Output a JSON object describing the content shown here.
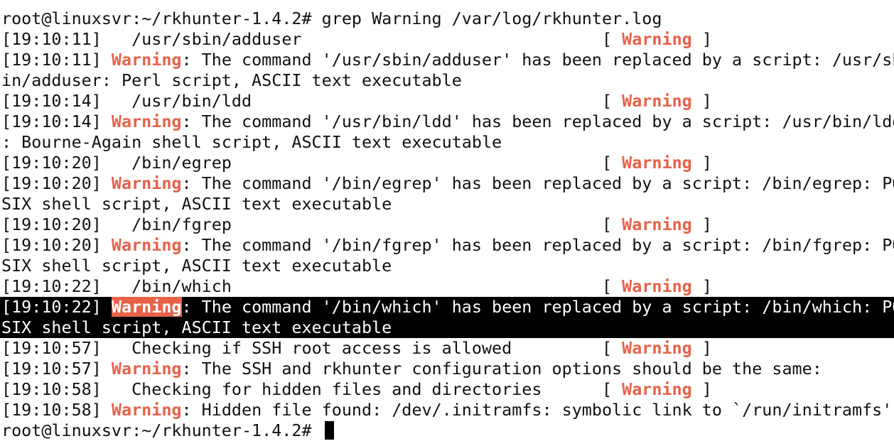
{
  "terminal": {
    "command_line": {
      "prompt": "root@linuxsvr:~/rkhunter-1.4.2#",
      "command": "grep Warning /var/log/rkhunter.log"
    },
    "warning_word": "Warning",
    "status_open": "[ ",
    "status_close": " ]",
    "lines": [
      {
        "kind": "status",
        "time": "[19:10:11]",
        "text": "  /usr/sbin/adduser"
      },
      {
        "kind": "message",
        "time": "[19:10:11]",
        "text": ": The command '/usr/sbin/adduser' has been replaced by a script: /usr/sb"
      },
      {
        "kind": "cont",
        "text": "in/adduser: Perl script, ASCII text executable"
      },
      {
        "kind": "status",
        "time": "[19:10:14]",
        "text": "  /usr/bin/ldd"
      },
      {
        "kind": "message",
        "time": "[19:10:14]",
        "text": ": The command '/usr/bin/ldd' has been replaced by a script: /usr/bin/ldd"
      },
      {
        "kind": "cont",
        "text": ": Bourne-Again shell script, ASCII text executable"
      },
      {
        "kind": "status",
        "time": "[19:10:20]",
        "text": "  /bin/egrep"
      },
      {
        "kind": "message",
        "time": "[19:10:20]",
        "text": ": The command '/bin/egrep' has been replaced by a script: /bin/egrep: PO"
      },
      {
        "kind": "cont",
        "text": "SIX shell script, ASCII text executable"
      },
      {
        "kind": "status",
        "time": "[19:10:20]",
        "text": "  /bin/fgrep"
      },
      {
        "kind": "message",
        "time": "[19:10:20]",
        "text": ": The command '/bin/fgrep' has been replaced by a script: /bin/fgrep: PO"
      },
      {
        "kind": "cont",
        "text": "SIX shell script, ASCII text executable"
      },
      {
        "kind": "status",
        "time": "[19:10:22]",
        "text": "  /bin/which"
      },
      {
        "kind": "message",
        "time": "[19:10:22]",
        "text": ": The command '/bin/which' has been replaced by a script: /bin/which: PO",
        "highlight": true
      },
      {
        "kind": "cont",
        "text": "SIX shell script, ASCII text executable",
        "highlight": true
      },
      {
        "kind": "status",
        "time": "[19:10:57]",
        "text": "  Checking if SSH root access is allowed"
      },
      {
        "kind": "message",
        "time": "[19:10:57]",
        "text": ": The SSH and rkhunter configuration options should be the same:"
      },
      {
        "kind": "status",
        "time": "[19:10:58]",
        "text": "  Checking for hidden files and directories"
      },
      {
        "kind": "message",
        "time": "[19:10:58]",
        "text": ": Hidden file found: /dev/.initramfs: symbolic link to `/run/initramfs'"
      }
    ],
    "final_prompt": "root@linuxsvr:~/rkhunter-1.4.2#"
  },
  "colors": {
    "background": "#ffffff",
    "text": "#111111",
    "warning": "#e8624a",
    "highlight_bg": "#000000"
  }
}
